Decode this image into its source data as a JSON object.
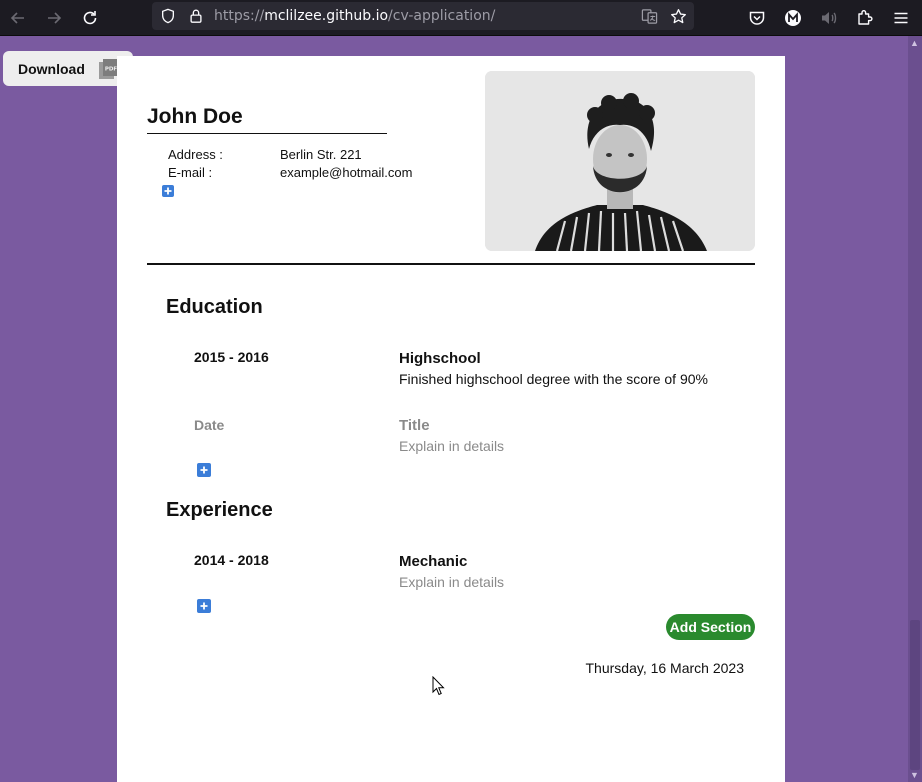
{
  "browser": {
    "url_prefix": "https://",
    "url_host": "mclilzee.github.io",
    "url_path": "/cv-application/"
  },
  "page": {
    "download_label": "Download",
    "cv": {
      "name": "John Doe",
      "info": [
        {
          "label": "Address :",
          "value": "Berlin Str. 221"
        },
        {
          "label": "E-mail :",
          "value": "example@hotmail.com"
        }
      ],
      "sections": [
        {
          "title": "Education",
          "entries": [
            {
              "date": "2015 - 2016",
              "title": "Highschool",
              "description": "Finished highschool degree with the score of 90%"
            },
            {
              "date": "Date",
              "title": "Title",
              "description": "Explain in details",
              "placeholder": true
            }
          ]
        },
        {
          "title": "Experience",
          "entries": [
            {
              "date": "2014 - 2018",
              "title": "Mechanic",
              "description": "Explain in details",
              "description_placeholder": true
            }
          ]
        }
      ],
      "add_section_label": "Add Section",
      "date": "Thursday, 16 March 2023"
    }
  },
  "colors": {
    "page_background": "#7a5aa0",
    "add_button": "#3b7dd8",
    "add_section": "#2a8a2e"
  }
}
